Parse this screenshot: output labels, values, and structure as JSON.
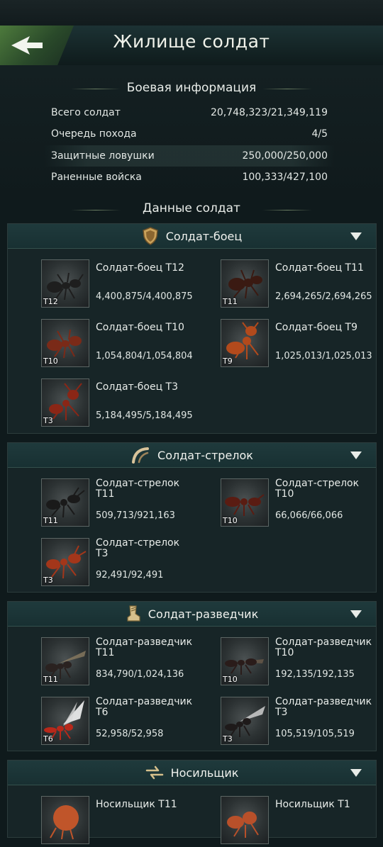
{
  "page_title": "Жилище солдат",
  "battle_info": {
    "heading": "Боевая информация",
    "rows": [
      {
        "label": "Всего солдат",
        "value": "20,748,323/21,349,119"
      },
      {
        "label": "Очередь похода",
        "value": "4/5"
      },
      {
        "label": "Защитные ловушки",
        "value": "250,000/250,000"
      },
      {
        "label": "Раненные войска",
        "value": "100,333/427,100"
      }
    ]
  },
  "soldier_data_heading": "Данные солдат",
  "sections": [
    {
      "title": "Солдат-боец",
      "icon": "shield-icon",
      "units": [
        {
          "name": "Солдат-боец T12",
          "count": "4,400,875/4,400,875",
          "tier": "T12",
          "color": "#1e1e1e"
        },
        {
          "name": "Солдат-боец T11",
          "count": "2,694,265/2,694,265",
          "tier": "T11",
          "color": "#3a1a12"
        },
        {
          "name": "Солдат-боец T10",
          "count": "1,054,804/1,054,804",
          "tier": "T10",
          "color": "#7a2a18"
        },
        {
          "name": "Солдат-боец T9",
          "count": "1,025,013/1,025,013",
          "tier": "T9",
          "color": "#b24a1c"
        },
        {
          "name": "Солдат-боец T3",
          "count": "5,184,495/5,184,495",
          "tier": "T3",
          "color": "#8a2616"
        }
      ]
    },
    {
      "title": "Солдат-стрелок",
      "icon": "bow-icon",
      "units": [
        {
          "name_line1": "Солдат-стрелок",
          "name_line2": "T11",
          "count": "509,713/921,163",
          "tier": "T11",
          "color": "#1a1a1a"
        },
        {
          "name_line1": "Солдат-стрелок",
          "name_line2": "T10",
          "count": "66,066/66,066",
          "tier": "T10",
          "color": "#5a1c12"
        },
        {
          "name_line1": "Солдат-стрелок",
          "name_line2": "T3",
          "count": "92,491/92,491",
          "tier": "T3",
          "color": "#a3361a"
        }
      ]
    },
    {
      "title": "Солдат-разведчик",
      "icon": "boot-icon",
      "units": [
        {
          "name_line1": "Солдат-разведчик",
          "name_line2": "T11",
          "count": "834,790/1,024,136",
          "tier": "T11",
          "color": "#2a2220"
        },
        {
          "name_line1": "Солдат-разведчик",
          "name_line2": "T10",
          "count": "192,135/192,135",
          "tier": "T10",
          "color": "#2a1c1a"
        },
        {
          "name_line1": "Солдат-разведчик",
          "name_line2": "T6",
          "count": "52,958/52,958",
          "tier": "T6",
          "color": "#b8281a"
        },
        {
          "name_line1": "Солдат-разведчик",
          "name_line2": "T3",
          "count": "105,519/105,519",
          "tier": "T3",
          "color": "#1e1a1a"
        }
      ]
    },
    {
      "title": "Носильщик",
      "icon": "transfer-icon",
      "units": [
        {
          "name": "Носильщик T11",
          "color": "#c0552a"
        },
        {
          "name": "Носильщик T1",
          "color": "#b8502a"
        }
      ]
    }
  ]
}
